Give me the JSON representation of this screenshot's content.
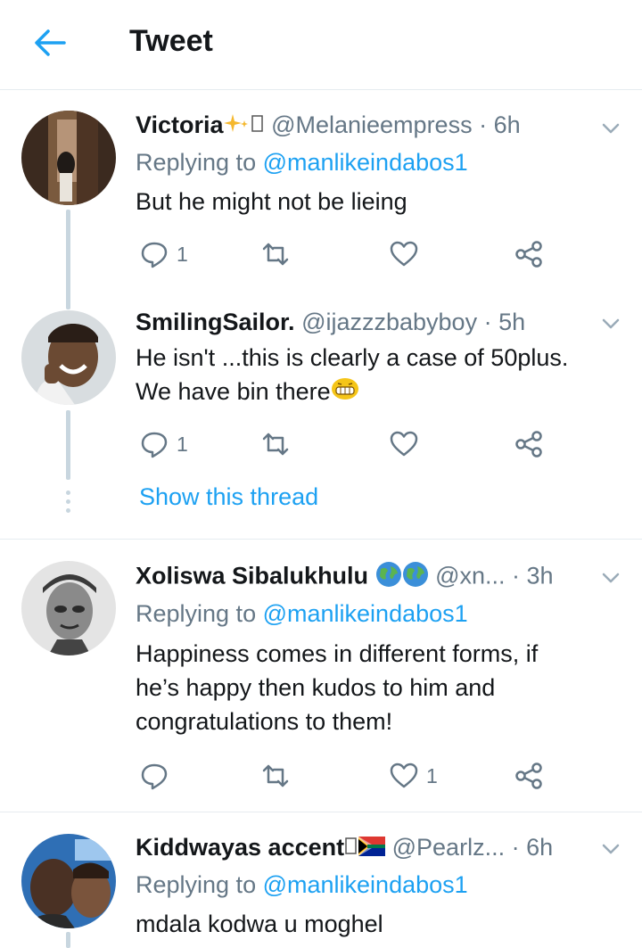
{
  "header": {
    "title": "Tweet"
  },
  "tweets": [
    {
      "name": "Victoria",
      "handle": "@Melanieempress",
      "time": "· 6h",
      "reply_label": "Replying to",
      "reply_handle": "@manlikeindabos1",
      "text": "But he might not be lieing",
      "reply_count": "1",
      "retweet_count": "",
      "like_count": ""
    },
    {
      "name": "SmilingSailor.",
      "handle": "@ijazzzbabyboy",
      "time": "· 5h",
      "text_lines": [
        "He isn't ...this is clearly a case of 50plus.",
        "We have bin there"
      ],
      "reply_count": "1",
      "retweet_count": "",
      "like_count": "",
      "show_thread": "Show this thread"
    },
    {
      "name": "Xoliswa Sibalukhulu",
      "handle": "@xn...",
      "time": "· 3h",
      "reply_label": "Replying to",
      "reply_handle": "@manlikeindabos1",
      "text_lines": [
        "Happiness comes in different forms, if",
        "he’s happy then kudos to him and",
        "congratulations to them!"
      ],
      "reply_count": "",
      "retweet_count": "",
      "like_count": "1"
    },
    {
      "name": "Kiddwayas accent",
      "handle": "@Pearlz...",
      "time": "· 6h",
      "reply_label": "Replying to",
      "reply_handle": "@manlikeindabos1",
      "text": "mdala kodwa u moghel"
    }
  ],
  "colors": {
    "accent": "#1da1f2",
    "muted": "#657786",
    "divider": "#e6ecf0",
    "thread": "#c8d6df"
  },
  "icons": [
    "back-arrow-icon",
    "chevron-down-icon",
    "reply-icon",
    "retweet-icon",
    "like-icon",
    "share-icon"
  ]
}
